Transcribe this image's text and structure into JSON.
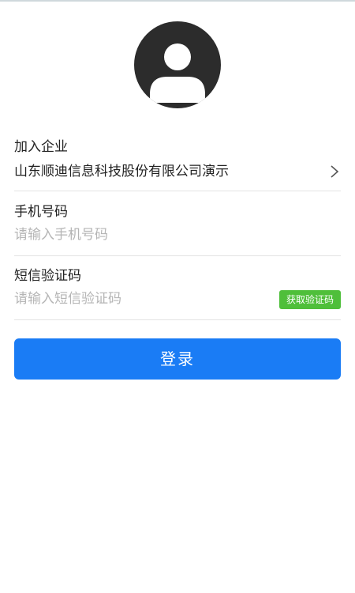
{
  "profile": {
    "avatar_icon": "user-avatar-icon"
  },
  "company": {
    "label": "加入企业",
    "value": "山东顺迪信息科技股份有限公司演示",
    "chevron_icon": "chevron-right-icon"
  },
  "phone": {
    "label": "手机号码",
    "placeholder": "请输入手机号码"
  },
  "sms": {
    "label": "短信验证码",
    "placeholder": "请输入短信验证码",
    "get_code_label": "获取验证码"
  },
  "login": {
    "label": "登录"
  },
  "colors": {
    "primary": "#1a7cf5",
    "code_button": "#4fbf3a",
    "placeholder": "#b5b5b5",
    "avatar": "#2c2c2c"
  }
}
